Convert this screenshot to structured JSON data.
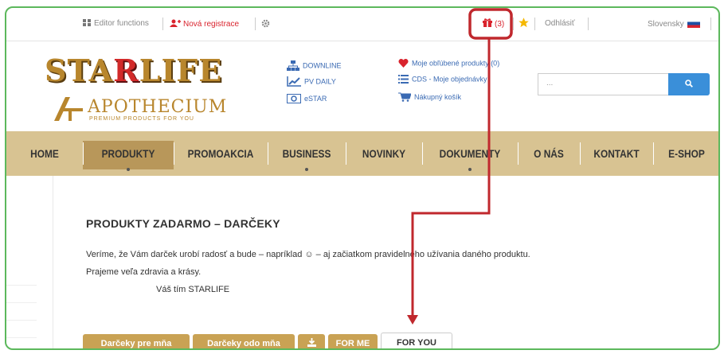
{
  "topbar": {
    "editor_label": "Editor functions",
    "registration_label": "Nová registrace",
    "gift_count": "(3)",
    "logout_label": "Odhlásiť",
    "language_label": "Slovensky"
  },
  "header": {
    "logo_main": "STARLIFE",
    "logo_sub_name": "APOTHECIUM",
    "logo_sub_tag": "PREMIUM PRODUCTS FOR YOU",
    "links": {
      "downline": "DOWNLINE",
      "pv_daily": "PV DAILY",
      "estar": "eSTAR",
      "favorites": "Moje obľúbené produkty (0)",
      "orders": "CDS - Moje objednávky",
      "cart": "Nákupný košík"
    },
    "search_placeholder": "...",
    "search_button_icon": "search-icon"
  },
  "nav": {
    "items": [
      "HOME",
      "PRODUKTY",
      "PROMOAKCIA",
      "BUSINESS",
      "NOVINKY",
      "DOKUMENTY",
      "O NÁS",
      "KONTAKT",
      "E-SHOP"
    ],
    "active": "PRODUKTY"
  },
  "content": {
    "title": "PRODUKTY ZADARMO – DARČEKY",
    "line1": "Veríme, že Vám darček urobí radosť a bude – napríklad ☺ – aj začiatkom pravidelného užívania daného produktu.",
    "line2": "Prajeme veľa zdravia a krásy.",
    "signature": "Váš tím STARLIFE"
  },
  "tabs": [
    {
      "label": "Darčeky pre mňa"
    },
    {
      "label": "Darčeky odo mňa"
    },
    {
      "label": "⭳",
      "icon": "download-icon"
    },
    {
      "label": "FOR ME"
    },
    {
      "label": "FOR YOU",
      "active": true
    }
  ],
  "colors": {
    "accent_gold": "#c9a254",
    "nav_bg": "#d8c392",
    "annotation_red": "#c0282d",
    "frame_green": "#5cb85c",
    "link_blue": "#3a6ab3"
  }
}
